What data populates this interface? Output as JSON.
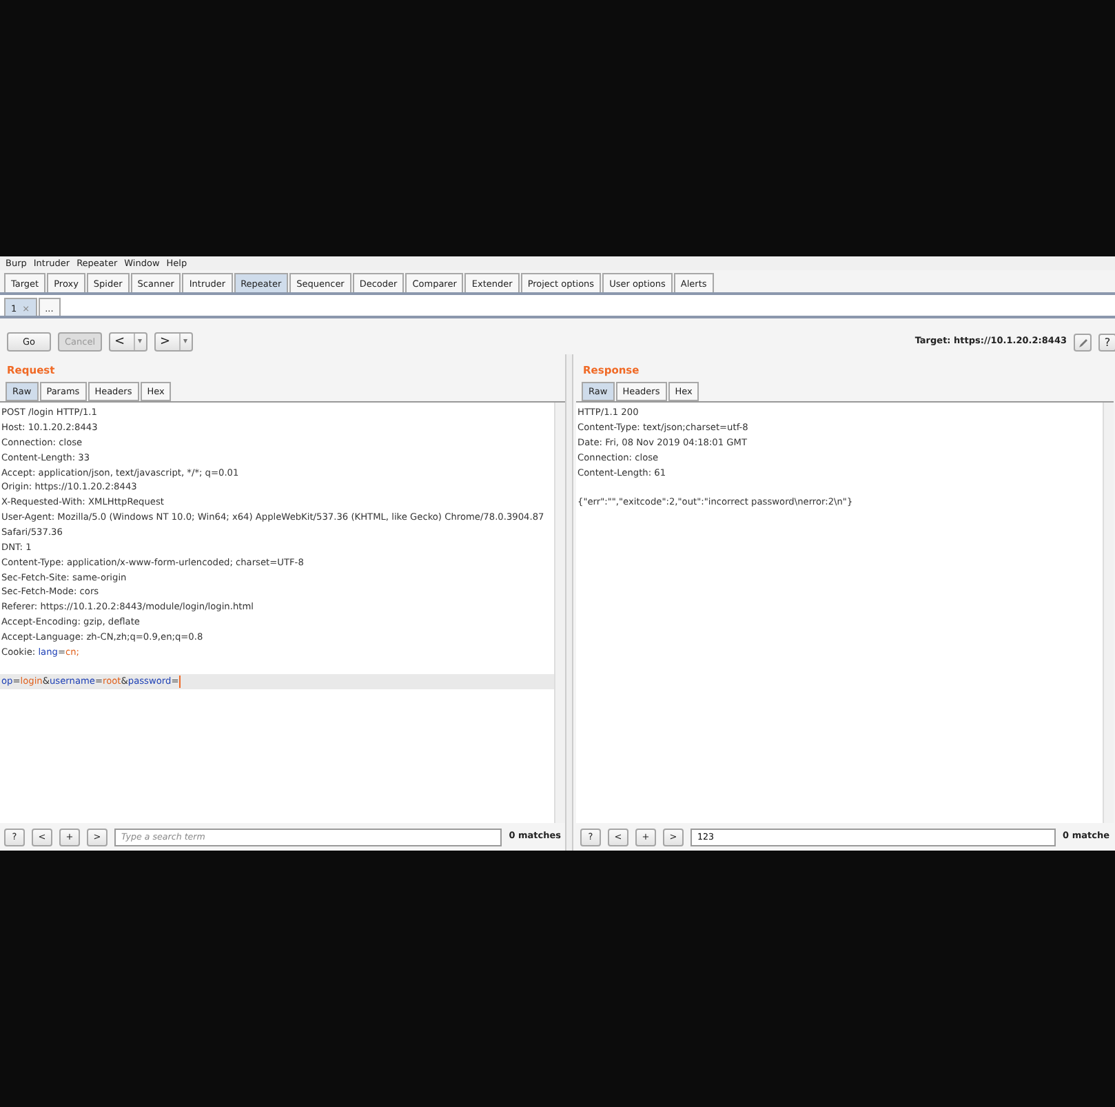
{
  "menu": [
    "Burp",
    "Intruder",
    "Repeater",
    "Window",
    "Help"
  ],
  "tabs": [
    {
      "label": "Target",
      "selected": false
    },
    {
      "label": "Proxy",
      "selected": false
    },
    {
      "label": "Spider",
      "selected": false
    },
    {
      "label": "Scanner",
      "selected": false
    },
    {
      "label": "Intruder",
      "selected": false
    },
    {
      "label": "Repeater",
      "selected": true
    },
    {
      "label": "Sequencer",
      "selected": false
    },
    {
      "label": "Decoder",
      "selected": false
    },
    {
      "label": "Comparer",
      "selected": false
    },
    {
      "label": "Extender",
      "selected": false
    },
    {
      "label": "Project options",
      "selected": false
    },
    {
      "label": "User options",
      "selected": false
    },
    {
      "label": "Alerts",
      "selected": false
    }
  ],
  "subtabs": [
    {
      "label": "1",
      "close": "×",
      "selected": true
    },
    {
      "label": "...",
      "selected": false
    }
  ],
  "toolbar": {
    "buttons": [
      {
        "label": "Go",
        "disabled": false
      },
      {
        "label": "Cancel",
        "disabled": true
      }
    ],
    "back": {
      "label": "<",
      "caret": "▾"
    },
    "forward": {
      "label": ">",
      "caret": "▾"
    },
    "target": "Target: https://10.1.20.2:8443",
    "help": "?"
  },
  "request": {
    "title": "Request",
    "tabs": [
      {
        "label": "Raw",
        "selected": true
      },
      {
        "label": "Params",
        "selected": false
      },
      {
        "label": "Headers",
        "selected": false
      },
      {
        "label": "Hex",
        "selected": false
      }
    ],
    "lines": [
      {
        "parts": [
          {
            "text": "POST /login HTTP/1.1",
            "kind": "plain"
          }
        ],
        "highlighted": false
      },
      {
        "parts": [
          {
            "text": "Host: 10.1.20.2:8443",
            "kind": "plain"
          }
        ],
        "highlighted": false
      },
      {
        "parts": [
          {
            "text": "Connection: close",
            "kind": "plain"
          }
        ],
        "highlighted": false
      },
      {
        "parts": [
          {
            "text": "Content-Length: 33",
            "kind": "plain"
          }
        ],
        "highlighted": false
      },
      {
        "parts": [
          {
            "text": "Accept: application/json, text/javascript, */*; q=0.01",
            "kind": "plain"
          }
        ],
        "highlighted": false
      },
      {
        "parts": [
          {
            "text": "Origin: https://10.1.20.2:8443",
            "kind": "plain"
          }
        ],
        "highlighted": false
      },
      {
        "parts": [
          {
            "text": "X-Requested-With: XMLHttpRequest",
            "kind": "plain"
          }
        ],
        "highlighted": false
      },
      {
        "parts": [
          {
            "text": "User-Agent: Mozilla/5.0 (Windows NT 10.0; Win64; x64) AppleWebKit/537.36 (KHTML, like Gecko) Chrome/78.0.3904.87",
            "kind": "plain"
          }
        ],
        "highlighted": false
      },
      {
        "parts": [
          {
            "text": "Safari/537.36",
            "kind": "plain"
          }
        ],
        "highlighted": false
      },
      {
        "parts": [
          {
            "text": "DNT: 1",
            "kind": "plain"
          }
        ],
        "highlighted": false
      },
      {
        "parts": [
          {
            "text": "Content-Type: application/x-www-form-urlencoded; charset=UTF-8",
            "kind": "plain"
          }
        ],
        "highlighted": false
      },
      {
        "parts": [
          {
            "text": "Sec-Fetch-Site: same-origin",
            "kind": "plain"
          }
        ],
        "highlighted": false
      },
      {
        "parts": [
          {
            "text": "Sec-Fetch-Mode: cors",
            "kind": "plain"
          }
        ],
        "highlighted": false
      },
      {
        "parts": [
          {
            "text": "Referer: https://10.1.20.2:8443/module/login/login.html",
            "kind": "plain"
          }
        ],
        "highlighted": false
      },
      {
        "parts": [
          {
            "text": "Accept-Encoding: gzip, deflate",
            "kind": "plain"
          }
        ],
        "highlighted": false
      },
      {
        "parts": [
          {
            "text": "Accept-Language: zh-CN,zh;q=0.9,en;q=0.8",
            "kind": "plain"
          }
        ],
        "highlighted": false
      },
      {
        "parts": [
          {
            "text": "Cookie: ",
            "kind": "plain"
          },
          {
            "text": "lang",
            "kind": "name"
          },
          {
            "text": "=",
            "kind": "plain"
          },
          {
            "text": "cn;",
            "kind": "value"
          }
        ],
        "highlighted": false
      },
      {
        "highlighted": false
      },
      {
        "parts": [
          {
            "text": "op",
            "kind": "name"
          },
          {
            "text": "=",
            "kind": "plain"
          },
          {
            "text": "login",
            "kind": "value"
          },
          {
            "text": "&",
            "kind": "plain"
          },
          {
            "text": "username",
            "kind": "name"
          },
          {
            "text": "=",
            "kind": "plain"
          },
          {
            "text": "root",
            "kind": "value"
          },
          {
            "text": "&",
            "kind": "plain"
          },
          {
            "text": "password",
            "kind": "name"
          },
          {
            "text": "=",
            "kind": "plain"
          }
        ],
        "highlighted": true
      }
    ],
    "search": {
      "buttons": [
        "?",
        "<",
        "+",
        ">"
      ],
      "placeholder": "Type a search term",
      "matches": "0 matches"
    }
  },
  "response": {
    "title": "Response",
    "tabs": [
      {
        "label": "Raw",
        "selected": true
      },
      {
        "label": "Headers",
        "selected": false
      },
      {
        "label": "Hex",
        "selected": false
      }
    ],
    "lines": [
      {
        "parts": [
          {
            "text": "HTTP/1.1 200",
            "kind": "plain"
          }
        ],
        "highlighted": false
      },
      {
        "parts": [
          {
            "text": "Content-Type: text/json;charset=utf-8",
            "kind": "plain"
          }
        ],
        "highlighted": false
      },
      {
        "parts": [
          {
            "text": "Date: Fri, 08 Nov 2019 04:18:01 GMT",
            "kind": "plain"
          }
        ],
        "highlighted": false
      },
      {
        "parts": [
          {
            "text": "Connection: close",
            "kind": "plain"
          }
        ],
        "highlighted": false
      },
      {
        "parts": [
          {
            "text": "Content-Length: 61",
            "kind": "plain"
          }
        ],
        "highlighted": false
      },
      {
        "highlighted": false
      },
      {
        "parts": [
          {
            "text": "{\"err\":\"\",\"exitcode\":2,\"out\":\"incorrect password\\nerror:2\\n\"}",
            "kind": "plain"
          }
        ],
        "highlighted": false
      }
    ],
    "search": {
      "buttons": [
        "?",
        "<",
        "+",
        ">"
      ],
      "value": "123",
      "matches": "0 matche"
    }
  }
}
